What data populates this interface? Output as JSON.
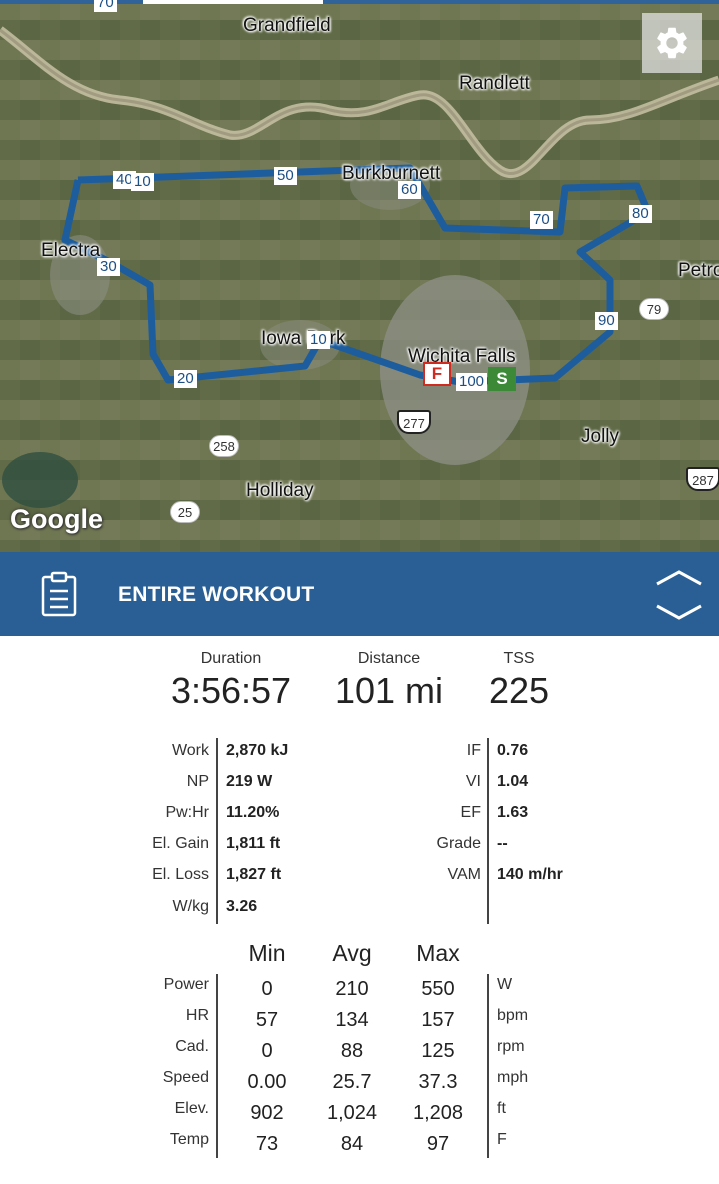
{
  "map": {
    "towns": [
      {
        "name": "Grandfield"
      },
      {
        "name": "Randlett"
      },
      {
        "name": "Burkburnett"
      },
      {
        "name": "Electra"
      },
      {
        "name": "Petro"
      },
      {
        "name": "Iowa Park"
      },
      {
        "name": "Wichita Falls"
      },
      {
        "name": "Jolly"
      },
      {
        "name": "Holliday"
      }
    ],
    "mile_markers": [
      "40",
      "10",
      "50",
      "60",
      "70",
      "80",
      "30",
      "90",
      "20",
      "10",
      "100"
    ],
    "top_partial_shield": "70",
    "road_shields": [
      "79",
      "258",
      "25",
      "277",
      "287"
    ],
    "start_marker": "S",
    "finish_marker": "F",
    "google_logo": "Google",
    "route_color": "#1d5d9e"
  },
  "header": {
    "title": "ENTIRE WORKOUT",
    "bar_color": "#2a5f96"
  },
  "summary": [
    {
      "label": "Duration",
      "value": "3:56:57"
    },
    {
      "label": "Distance",
      "value": "101 mi"
    },
    {
      "label": "TSS",
      "value": "225"
    }
  ],
  "details_left": [
    {
      "label": "Work",
      "value": "2,870 kJ"
    },
    {
      "label": "NP",
      "value": "219 W"
    },
    {
      "label": "Pw:Hr",
      "value": "11.20%"
    },
    {
      "label": "El. Gain",
      "value": "1,811 ft"
    },
    {
      "label": "El. Loss",
      "value": "1,827 ft"
    },
    {
      "label": "W/kg",
      "value": "3.26"
    }
  ],
  "details_right": [
    {
      "label": "IF",
      "value": "0.76"
    },
    {
      "label": "VI",
      "value": "1.04"
    },
    {
      "label": "EF",
      "value": "1.63"
    },
    {
      "label": "Grade",
      "value": "--"
    },
    {
      "label": "VAM",
      "value": "140 m/hr"
    }
  ],
  "stats": {
    "columns": [
      "Min",
      "Avg",
      "Max"
    ],
    "rows": [
      {
        "label": "Power",
        "min": "0",
        "avg": "210",
        "max": "550",
        "unit": "W"
      },
      {
        "label": "HR",
        "min": "57",
        "avg": "134",
        "max": "157",
        "unit": "bpm"
      },
      {
        "label": "Cad.",
        "min": "0",
        "avg": "88",
        "max": "125",
        "unit": "rpm"
      },
      {
        "label": "Speed",
        "min": "0.00",
        "avg": "25.7",
        "max": "37.3",
        "unit": "mph"
      },
      {
        "label": "Elev.",
        "min": "902",
        "avg": "1,024",
        "max": "1,208",
        "unit": "ft"
      },
      {
        "label": "Temp",
        "min": "73",
        "avg": "84",
        "max": "97",
        "unit": "F"
      }
    ]
  }
}
